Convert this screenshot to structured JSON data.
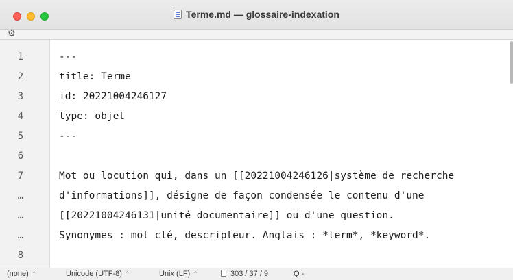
{
  "window": {
    "title": "Terme.md — glossaire-indexation"
  },
  "toolbar": {
    "settings_icon": "gear-icon",
    "settings_glyph": "⚙"
  },
  "editor": {
    "gutter": [
      "1",
      "2",
      "3",
      "4",
      "5",
      "6",
      "7",
      "…",
      "…",
      "…",
      "8"
    ],
    "lines": [
      "---",
      "title: Terme",
      "id: 20221004246127",
      "type: objet",
      "---",
      "",
      "Mot ou locution qui, dans un [[20221004246126|système de recherche",
      "d'informations]], désigne de façon condensée le contenu d'une",
      "[[20221004246131|unité documentaire]] ou d'une question.",
      "Synonymes : mot clé, descripteur. Anglais : *term*, *keyword*.",
      ""
    ]
  },
  "status": {
    "syntax": "(none)",
    "encoding": "Unicode (UTF-8)",
    "line_endings": "Unix (LF)",
    "counts": "303 / 37 / 9",
    "search_glyph": "Q -",
    "chevron": "⌃"
  },
  "colors": {
    "close": "#ff5f57",
    "minimize": "#febc2e",
    "maximize": "#28c840"
  }
}
